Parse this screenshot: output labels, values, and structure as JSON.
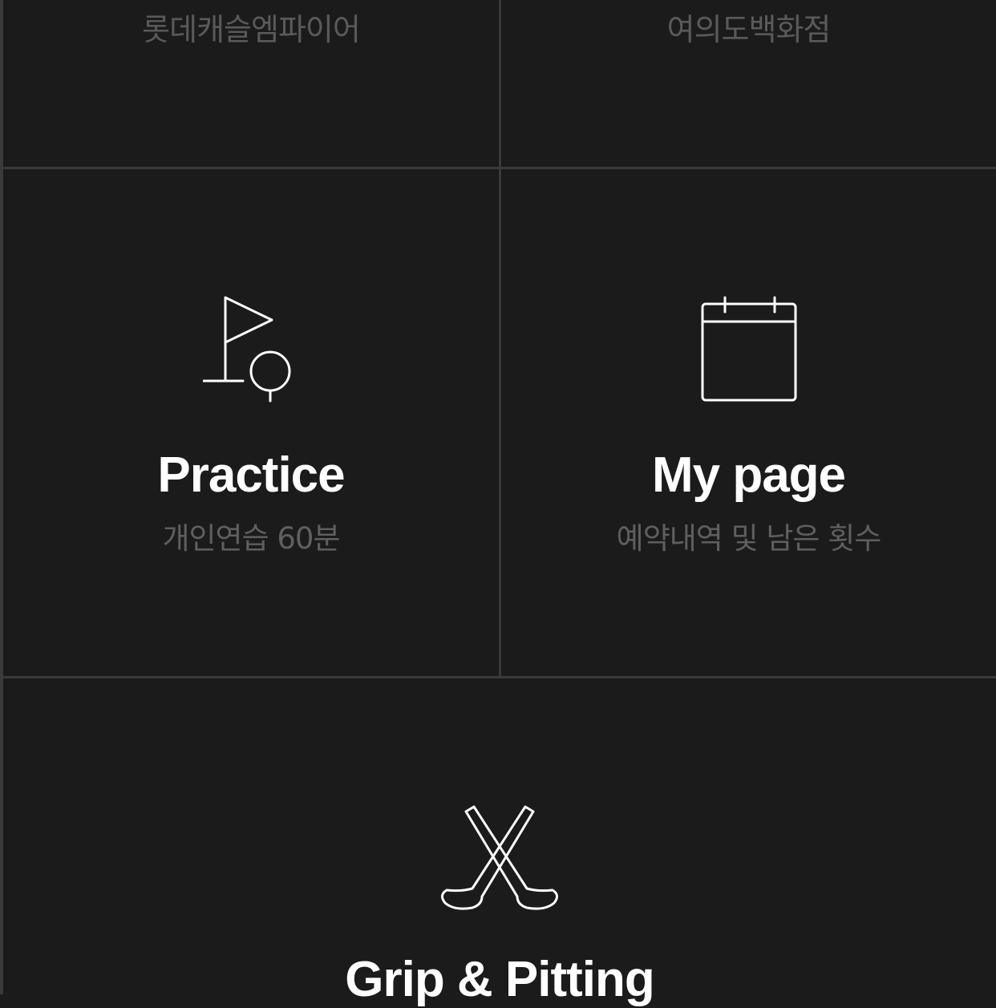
{
  "stores": [
    {
      "label": "롯데캐슬엠파이어"
    },
    {
      "label": "여의도백화점"
    }
  ],
  "menu": [
    {
      "title": "Practice",
      "subtitle": "개인연습 60분",
      "icon": "golf-flag-icon"
    },
    {
      "title": "My page",
      "subtitle": "예약내역 및 남은 횟수",
      "icon": "calendar-icon"
    },
    {
      "title": "Grip & Pitting",
      "icon": "crossed-golf-clubs-icon"
    }
  ],
  "colors": {
    "background": "#1b1b1c",
    "divider": "#3a3a3b",
    "title": "#ffffff",
    "subtitle": "#5f5f60"
  }
}
